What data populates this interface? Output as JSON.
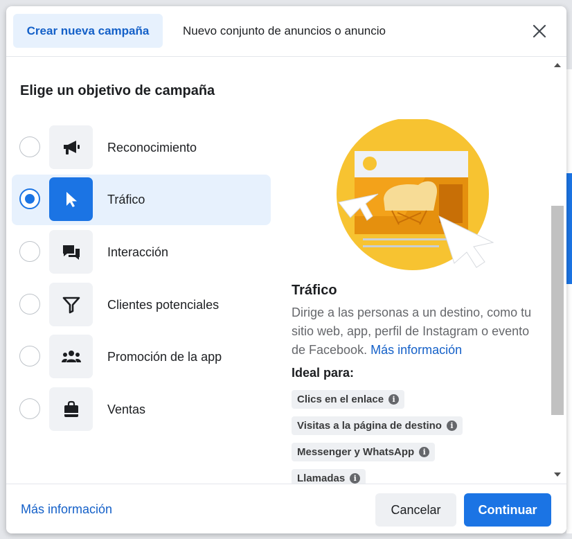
{
  "colors": {
    "accent": "#1b74e4",
    "selected_bg": "#e7f1fd",
    "link": "#1460c8"
  },
  "header": {
    "active_tab": "Crear nueva campaña",
    "inactive_tab": "Nuevo conjunto de anuncios o anuncio",
    "close_icon": "close-icon"
  },
  "objectives": {
    "title": "Elige un objetivo de campaña",
    "selected": "Tráfico",
    "items": [
      {
        "label": "Reconocimiento",
        "icon": "megaphone-icon"
      },
      {
        "label": "Tráfico",
        "icon": "cursor-icon"
      },
      {
        "label": "Interacción",
        "icon": "chat-bubbles-icon"
      },
      {
        "label": "Clientes potenciales",
        "icon": "funnel-icon"
      },
      {
        "label": "Promoción de la app",
        "icon": "people-icon"
      },
      {
        "label": "Ventas",
        "icon": "shopping-bag-icon"
      }
    ]
  },
  "detail": {
    "title": "Tráfico",
    "description": "Dirige a las personas a un destino, como tu sitio web, app, perfil de Instagram o evento de Facebook.",
    "link": "Más información",
    "ideal_label": "Ideal para:",
    "chips": [
      "Clics en el enlace",
      "Visitas a la página de destino",
      "Messenger y WhatsApp",
      "Llamadas"
    ]
  },
  "footer": {
    "link": "Más información",
    "cancel": "Cancelar",
    "continue": "Continuar"
  }
}
